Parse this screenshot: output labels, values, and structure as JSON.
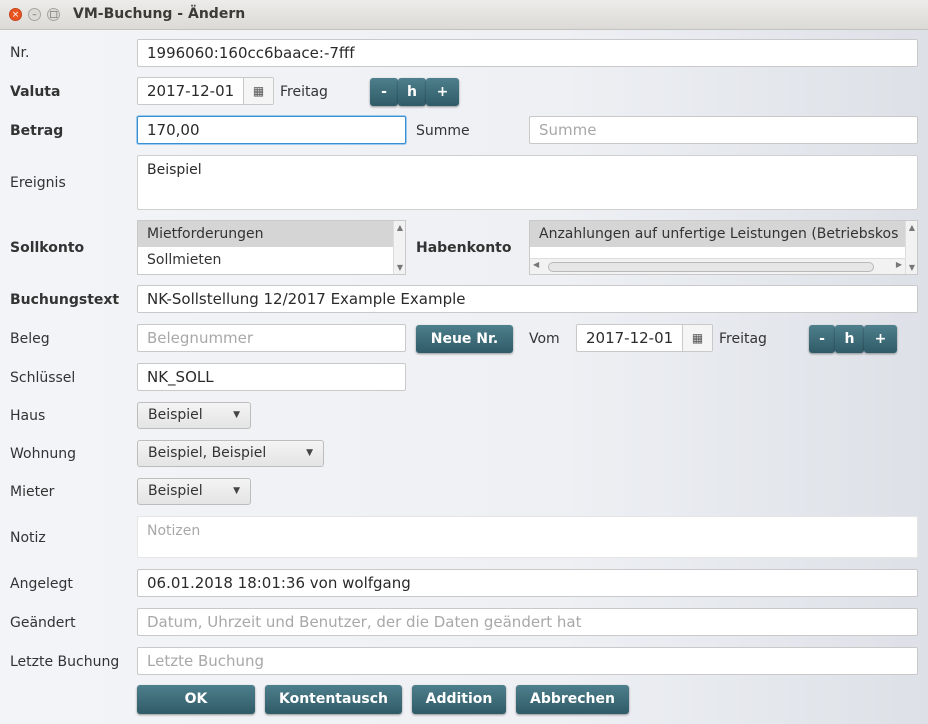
{
  "window": {
    "title": "VM-Buchung - Ändern",
    "controls": {
      "close": "×",
      "minimize": "–",
      "maximize": "□"
    }
  },
  "form": {
    "nr": {
      "label": "Nr.",
      "value": "1996060:160cc6baace:-7fff"
    },
    "valuta": {
      "label": "Valuta",
      "date": "2017-12-01",
      "weekday": "Freitag",
      "buttons": {
        "minus": "-",
        "h": "h",
        "plus": "+"
      }
    },
    "betrag": {
      "label": "Betrag",
      "value": "170,00",
      "summe_label": "Summe",
      "summe_placeholder": "Summe"
    },
    "ereignis": {
      "label": "Ereignis",
      "value": "Beispiel"
    },
    "sollkonto": {
      "label": "Sollkonto",
      "items": [
        "Mietforderungen",
        "Sollmieten"
      ]
    },
    "habenkonto": {
      "label": "Habenkonto",
      "items": [
        "Anzahlungen auf unfertige Leistungen (Betriebskos"
      ]
    },
    "buchungstext": {
      "label": "Buchungstext",
      "value": "NK-Sollstellung 12/2017 Example Example"
    },
    "beleg": {
      "label": "Beleg",
      "placeholder": "Belegnummer",
      "neue_nr": "Neue Nr.",
      "vom_label": "Vom",
      "date": "2017-12-01",
      "weekday": "Freitag",
      "buttons": {
        "minus": "-",
        "h": "h",
        "plus": "+"
      }
    },
    "schluessel": {
      "label": "Schlüssel",
      "value": "NK_SOLL"
    },
    "haus": {
      "label": "Haus",
      "value": "Beispiel"
    },
    "wohnung": {
      "label": "Wohnung",
      "value": "Beispiel, Beispiel"
    },
    "mieter": {
      "label": "Mieter",
      "value": "Beispiel"
    },
    "notiz": {
      "label": "Notiz",
      "placeholder": "Notizen"
    },
    "angelegt": {
      "label": "Angelegt",
      "value": "06.01.2018 18:01:36 von wolfgang"
    },
    "geaendert": {
      "label": "Geändert",
      "placeholder": "Datum, Uhrzeit und Benutzer, der die Daten geändert hat"
    },
    "letzte_buchung": {
      "label": "Letzte Buchung",
      "placeholder": "Letzte Buchung"
    }
  },
  "actions": {
    "ok": "OK",
    "kontentausch": "Kontentausch",
    "addition": "Addition",
    "abbrechen": "Abbrechen"
  },
  "icons": {
    "calendar": "▦",
    "caret": "▼",
    "scroll_up": "▲",
    "scroll_down": "▼",
    "scroll_left": "◀",
    "scroll_right": "▶"
  },
  "colors": {
    "accent_button": "#3b6b77",
    "focus_border": "#3a8fd0",
    "close_button": "#e95420"
  }
}
